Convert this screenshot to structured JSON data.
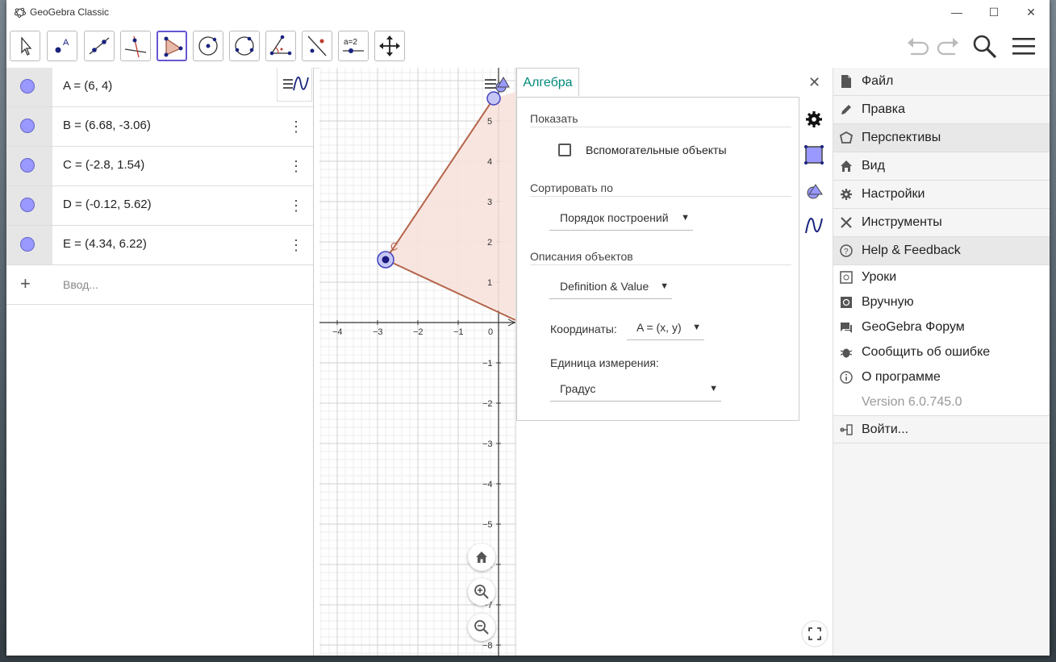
{
  "window": {
    "title": "GeoGebra Classic",
    "minimize": "—",
    "maximize": "☐",
    "close": "✕"
  },
  "toolbar": {
    "tools": [
      "move-tool",
      "point-tool",
      "line-tool",
      "perpendicular-tool",
      "polygon-tool",
      "circle-tool",
      "circle-three-points-tool",
      "angle-tool",
      "reflect-tool",
      "slider-tool",
      "move-graphics-tool"
    ],
    "selected": "polygon-tool",
    "slider_label": "a=2"
  },
  "algebra": {
    "rows": [
      {
        "expr": "A = (6, 4)"
      },
      {
        "expr": "B = (6.68, -3.06)"
      },
      {
        "expr": "C = (-2.8, 1.54)"
      },
      {
        "expr": "D = (-0.12, 5.62)"
      },
      {
        "expr": "E = (4.34, 6.22)"
      }
    ],
    "input_placeholder": "Ввод..."
  },
  "graphics": {
    "x_ticks": [
      "−4",
      "−3",
      "−2",
      "−1",
      "0"
    ],
    "y_ticks": [
      "5",
      "4",
      "3",
      "2",
      "1",
      "−1",
      "−2",
      "−3",
      "−4",
      "−5",
      "−6",
      "−7",
      "−8"
    ],
    "point_label": "C",
    "colors": {
      "polygon_fill": "#f7e2dc",
      "polygon_edge": "#b5654b",
      "point": "#4040c0"
    }
  },
  "properties": {
    "tab": "Алгебра",
    "show_label": "Показать",
    "aux_objects": "Вспомогательные объекты",
    "sort_label": "Сортировать по",
    "sort_value": "Порядок построений",
    "desc_label": "Описания объектов",
    "desc_value": "Definition & Value",
    "coords_label": "Координаты:",
    "coords_value": "A = (x, y)",
    "unit_label": "Единица измерения:",
    "unit_value": "Градус"
  },
  "menu": {
    "items": [
      "Файл",
      "Правка",
      "Перспективы",
      "Вид",
      "Настройки",
      "Инструменты",
      "Help & Feedback"
    ],
    "sub_items": [
      "Уроки",
      "Вручную",
      "GeoGebra Форум",
      "Сообщить об ошибке",
      "О программе"
    ],
    "version": "Version 6.0.745.0",
    "signin": "Войти..."
  }
}
